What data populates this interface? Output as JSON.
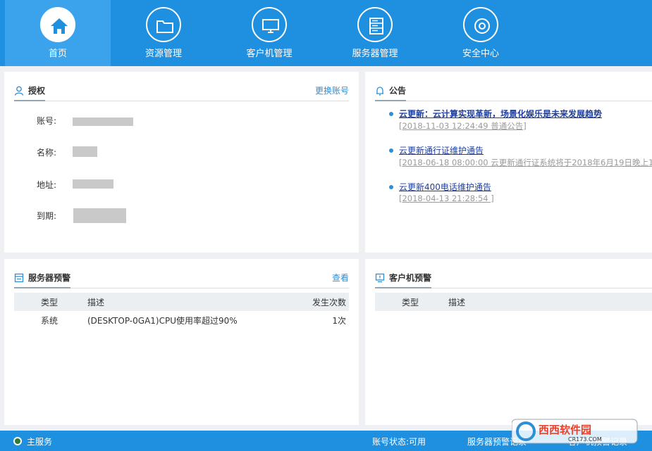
{
  "nav": {
    "items": [
      {
        "label": "首页",
        "icon": "home-icon"
      },
      {
        "label": "资源管理",
        "icon": "folder-icon"
      },
      {
        "label": "客户机管理",
        "icon": "monitor-icon"
      },
      {
        "label": "服务器管理",
        "icon": "server-icon"
      },
      {
        "label": "安全中心",
        "icon": "target-icon"
      }
    ],
    "active": "首页"
  },
  "auth": {
    "title": "授权",
    "switch_account": "更换账号",
    "fields": [
      {
        "label": "账号:",
        "value": "(redacted)"
      },
      {
        "label": "名称:",
        "value": "(redacted)"
      },
      {
        "label": "地址:",
        "value": "(redacted)"
      },
      {
        "label": "到期:",
        "value": "(redacted)"
      }
    ]
  },
  "announcements": {
    "title": "公告",
    "items": [
      {
        "title": "云更新：云计算实现革新，场景化娱乐是未来发展趋势",
        "meta": "[2018-11-03 12:24:49 普通公告]"
      },
      {
        "title": "云更新通行证维护通告",
        "meta": "[2018-06-18 08:00:00  云更新通行证系统将于2018年6月19日晚上1"
      },
      {
        "title": "云更新400电话维护通告",
        "meta": "[2018-04-13 21:28:54 ]"
      }
    ]
  },
  "server_alerts": {
    "title": "服务器预警",
    "view_link": "查看",
    "columns": [
      "类型",
      "描述",
      "发生次数"
    ],
    "rows": [
      {
        "type": "系统",
        "desc": "(DESKTOP-0GA1)CPU使用率超过90%",
        "count": "1次"
      }
    ]
  },
  "client_alerts": {
    "title": "客户机预警",
    "columns": [
      "类型",
      "描述"
    ]
  },
  "statusbar": {
    "service": "主服务",
    "account_status": "账号状态:可用",
    "server_alert_log": "服务器预警记录",
    "client_alert_log": "客户机预警记录"
  },
  "watermark": {
    "text": "西西软件园",
    "sub": "CR173.COM"
  },
  "colors": {
    "primary": "#1f8fe0",
    "active_tab": "#3aa3eb",
    "link": "#2d8fd5",
    "announcement": "#1f3f9f"
  }
}
